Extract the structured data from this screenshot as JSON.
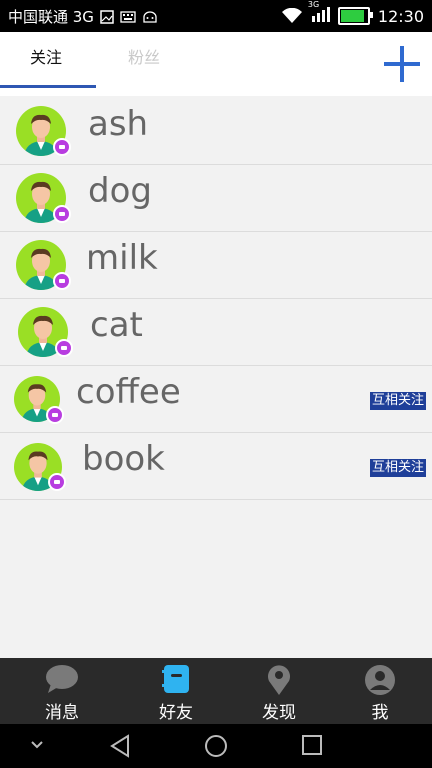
{
  "statusbar": {
    "carrier": "中国联通 3G",
    "network_badge": "3G",
    "time": "12:30",
    "icons": [
      "image-icon",
      "keyboard-icon",
      "android-icon",
      "wifi-icon",
      "signal-icon",
      "battery-icon"
    ]
  },
  "header": {
    "tabs": [
      {
        "label": "关注",
        "active": true
      },
      {
        "label": "粉丝",
        "active": false
      }
    ],
    "add_icon": "plus-icon",
    "accent_color": "#2f6ad0"
  },
  "contacts": [
    {
      "name": "ash",
      "mutual": ""
    },
    {
      "name": "dog",
      "mutual": ""
    },
    {
      "name": "milk",
      "mutual": ""
    },
    {
      "name": "cat",
      "mutual": ""
    },
    {
      "name": "coffee",
      "mutual": "互相关注"
    },
    {
      "name": "book",
      "mutual": "互相关注"
    }
  ],
  "bottom_nav": [
    {
      "label": "消息",
      "icon": "chat-bubble-icon",
      "active": false
    },
    {
      "label": "好友",
      "icon": "contacts-book-icon",
      "active": true
    },
    {
      "label": "发现",
      "icon": "location-pin-icon",
      "active": false
    },
    {
      "label": "我",
      "icon": "user-icon",
      "active": false
    }
  ],
  "system_nav": [
    "chevron-down-icon",
    "back-icon",
    "home-icon",
    "recents-icon"
  ],
  "colors": {
    "avatar_bg": "#9adf25",
    "video_badge": "#b83de0",
    "mutual_badge": "#1f3f99",
    "nav_active": "#2fb3f0"
  }
}
